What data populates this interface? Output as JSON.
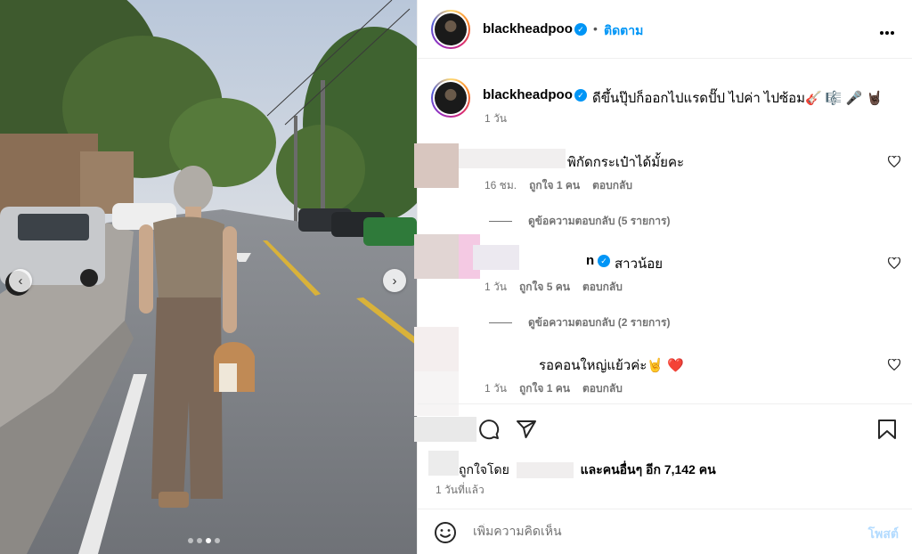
{
  "post": {
    "username": "blackheadpoo",
    "follow_label": "ติดตาม",
    "follow_separator": "•",
    "more_label": "•••",
    "caption": "ดีขึ้นปุ๊ปก็ออกไปแรดปั๊ป ไปค่า ไปซ้อม🎸 🎼 🎤 🤘🏿",
    "caption_time": "1 วัน"
  },
  "comments": [
    {
      "text": "พิกัดกระเป๋าได้มั้ยคะ",
      "time": "16 ชม.",
      "likes": "ถูกใจ 1 คน",
      "reply": "ตอบกลับ",
      "view_replies": "ดูข้อความตอบกลับ (5 รายการ)"
    },
    {
      "user_tail": "n",
      "text": "สาวน้อย",
      "time": "1 วัน",
      "likes": "ถูกใจ 5 คน",
      "reply": "ตอบกลับ",
      "view_replies": "ดูข้อความตอบกลับ (2 รายการ)"
    },
    {
      "text": "รอคอนใหญ่แย้วค่ะ🤘 ❤️",
      "time": "1 วัน",
      "likes": "ถูกใจ 1 คน",
      "reply": "ตอบกลับ"
    }
  ],
  "likes": {
    "prefix": "ถูกใจโดย",
    "suffix": "และคนอื่นๆ อีก 7,142 คน"
  },
  "posted_ago": "1 วันที่แล้ว",
  "comment_box": {
    "placeholder": "เพิ่มความคิดเห็น",
    "post_label": "โพสต์"
  },
  "carousel": {
    "slide_count": 4,
    "active_index": 2
  },
  "icons": {
    "prev": "chevron-left-icon",
    "next": "chevron-right-icon",
    "heart": "heart-icon",
    "comment": "comment-icon",
    "share": "share-icon",
    "save": "bookmark-icon",
    "emoji": "emoji-icon"
  },
  "colors": {
    "accent": "#0095f6",
    "muted": "#737373",
    "post_disabled": "#b3dbff"
  }
}
